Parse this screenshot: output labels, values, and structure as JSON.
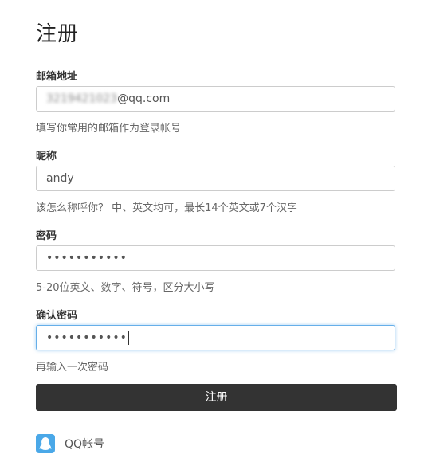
{
  "page_title": "注册",
  "email": {
    "label": "邮箱地址",
    "value_obscured": "3219421023",
    "value_suffix": "@qq.com",
    "hint": "填写你常用的邮箱作为登录帐号"
  },
  "nickname": {
    "label": "昵称",
    "value": "andy",
    "hint": "该怎么称呼你？ 中、英文均可，最长14个英文或7个汉字"
  },
  "password": {
    "label": "密码",
    "value": "•••••••••••",
    "hint": "5-20位英文、数字、符号，区分大小写"
  },
  "confirm_password": {
    "label": "确认密码",
    "value": "•••••••••••",
    "hint": "再输入一次密码"
  },
  "submit": {
    "label": "注册"
  },
  "social": {
    "qq_label": "QQ帐号",
    "qq_icon": "qq-penguin-icon"
  },
  "colors": {
    "accent_button": "#333333",
    "focus_border": "#66afe9",
    "qq_blue": "#4aa8e8"
  }
}
